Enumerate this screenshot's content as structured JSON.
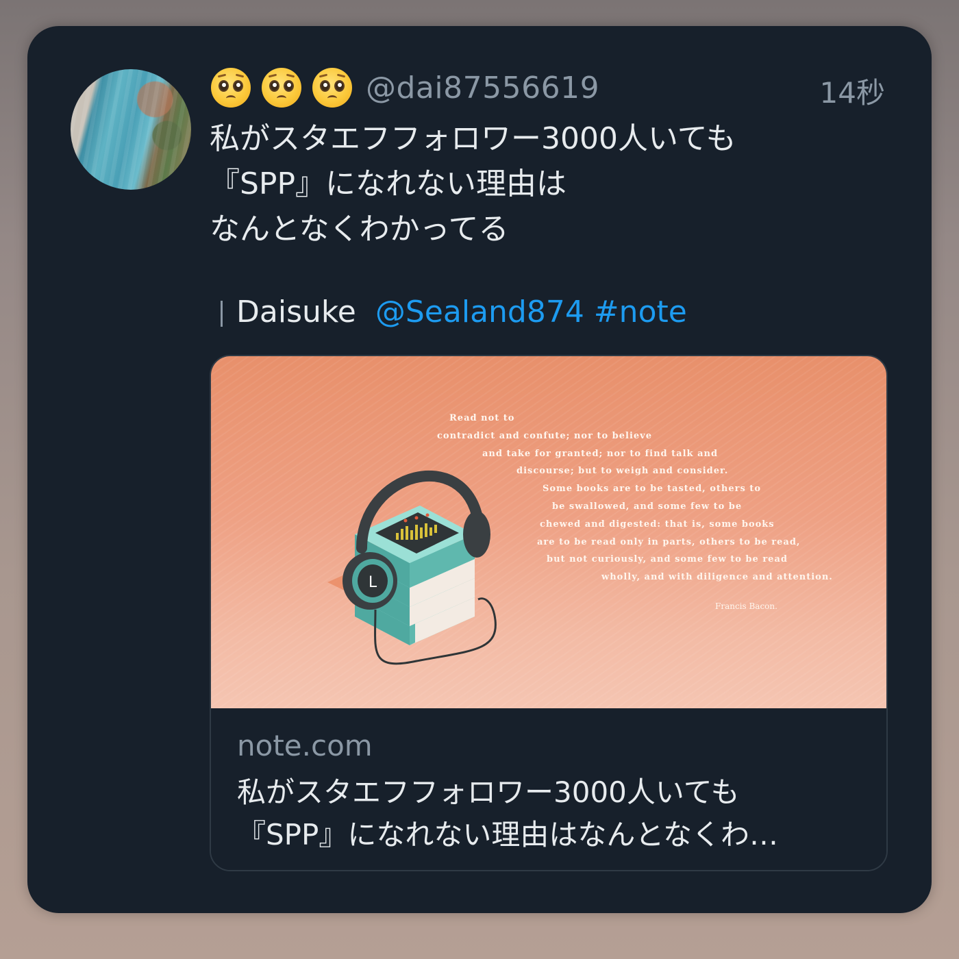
{
  "tweet": {
    "emojis": [
      "pleading-face",
      "pleading-face",
      "pleading-face"
    ],
    "handle": "@dai87556619",
    "timestamp": "14秒",
    "text_lines": [
      "私がスタエフフォロワー3000人いても",
      "『SPP』になれない理由は",
      "なんとなくわかってる"
    ],
    "quote": {
      "author": "Daisuke",
      "mention_tag": "@Sealand874 #note"
    }
  },
  "link_card": {
    "domain": "note.com",
    "title_lines": [
      "私がスタエフフォロワー3000人いても",
      "『SPP』になれない理由はなんとなくわ…"
    ],
    "image": {
      "poem_lines": [
        "Read not to",
        "contradict and confute; nor to believe",
        "and take for granted; nor to find talk and",
        "discourse; but to weigh and consider.",
        "Some books are to be tasted, others to",
        "be swallowed, and some few to be",
        "chewed and digested: that is, some books",
        "are to be read only in parts, others to be read,",
        "but not curiously, and some few to be read",
        "wholly, and with diligence and attention."
      ],
      "poem_author": "Francis Bacon.",
      "headphone_letter": "L"
    }
  },
  "colors": {
    "card_background": "#17202b",
    "link_blue": "#1d9bf0",
    "muted_text": "#8b98a5",
    "image_salmon": "#e8906b",
    "books_teal": "#6cc5bd"
  }
}
